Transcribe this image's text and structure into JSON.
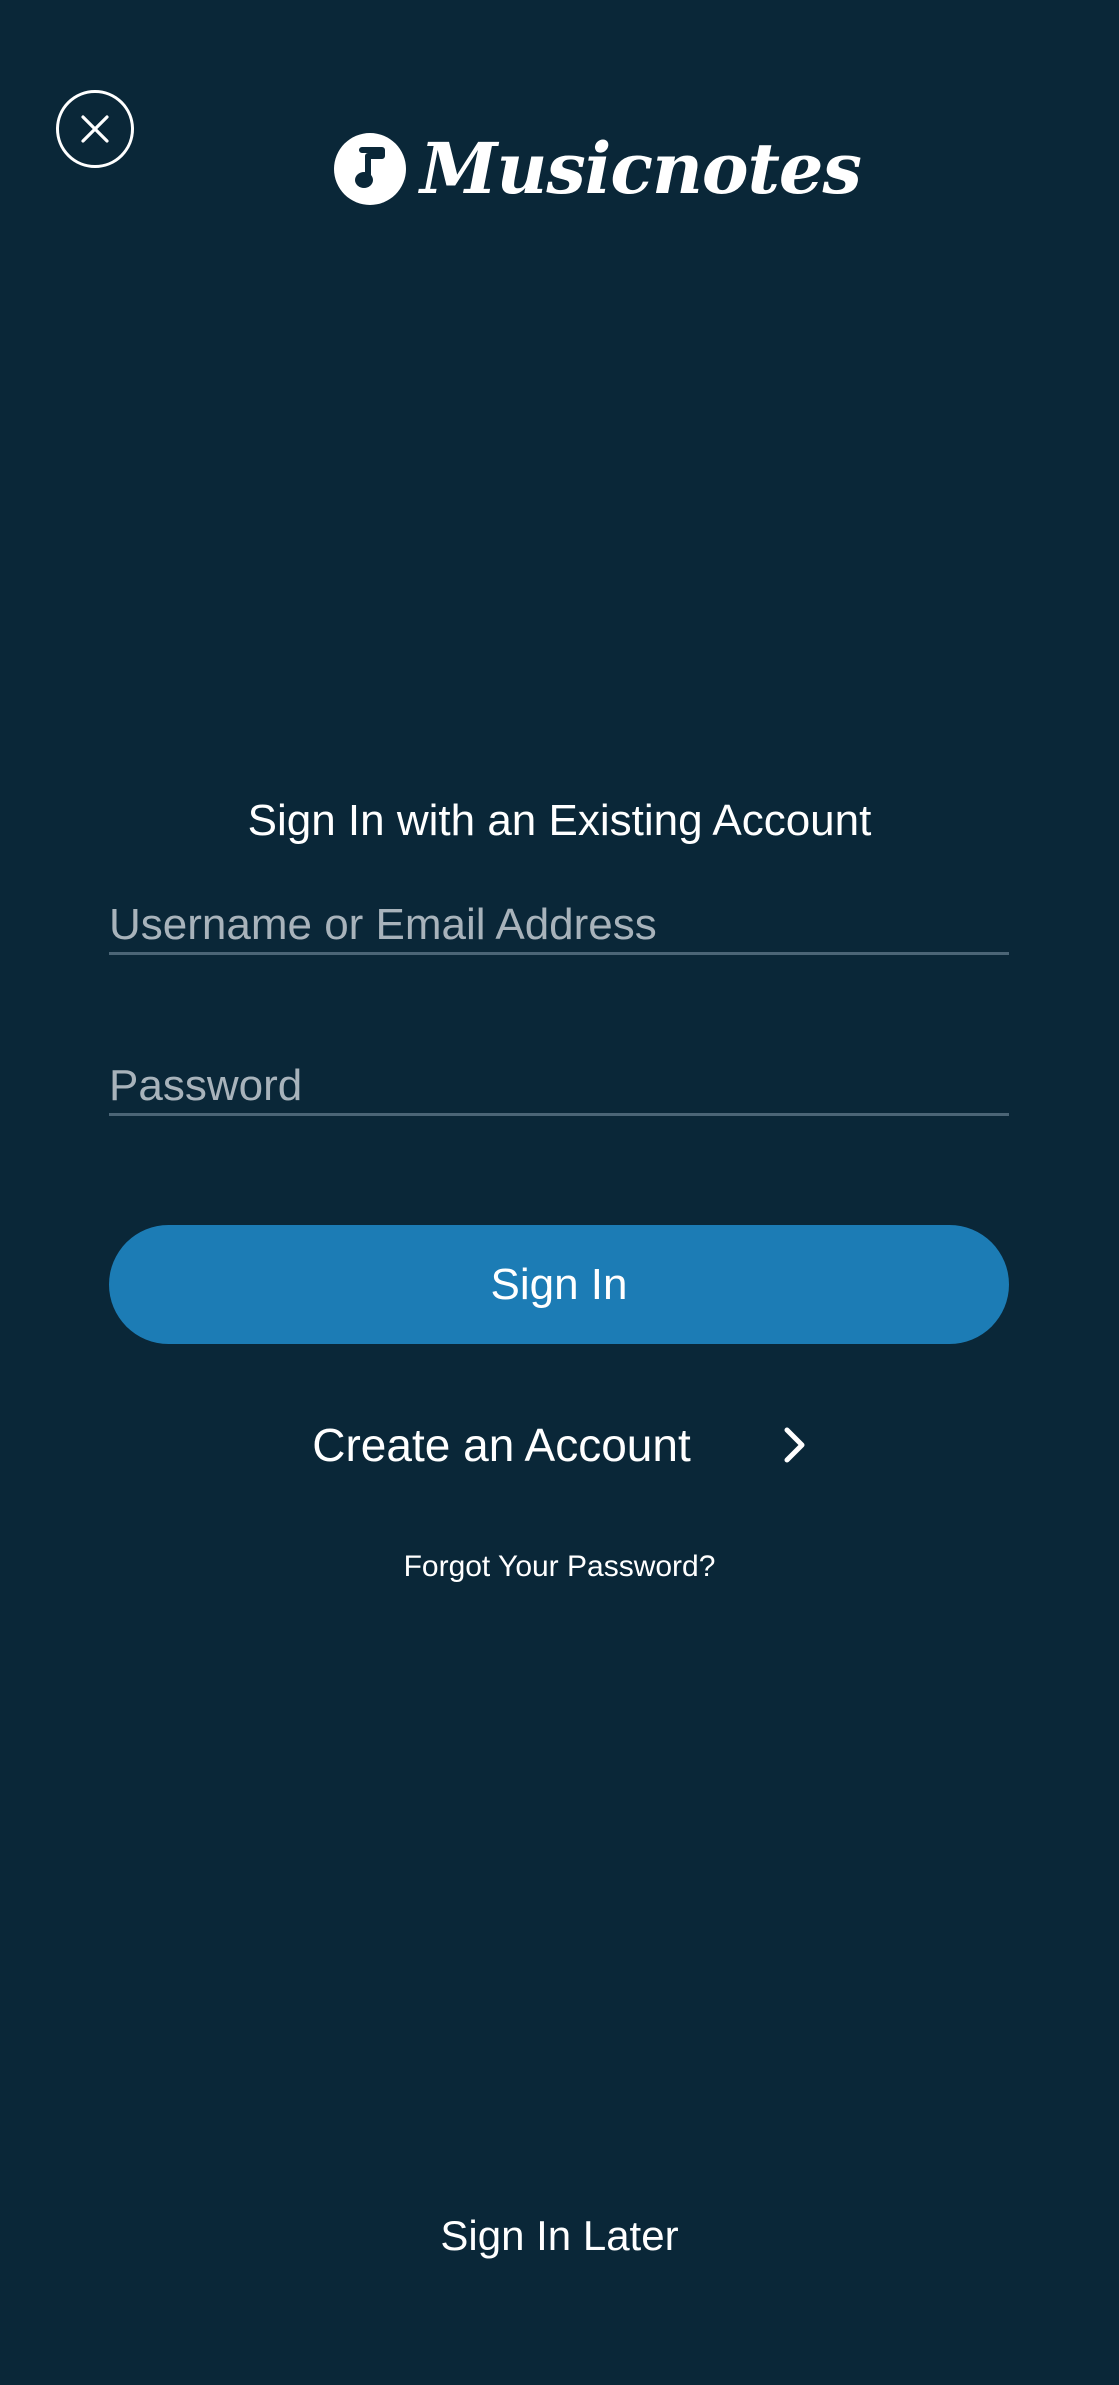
{
  "header": {
    "close_icon": "close-icon",
    "logo_text": "Musicnotes",
    "logo_icon": "music-note-icon"
  },
  "form": {
    "heading": "Sign In with an Existing Account",
    "username_placeholder": "Username or Email Address",
    "username_value": "",
    "password_placeholder": "Password",
    "password_value": "",
    "sign_in_label": "Sign In"
  },
  "links": {
    "create_account_label": "Create an Account",
    "create_account_icon": "chevron-right-icon",
    "forgot_password_label": "Forgot Your Password?",
    "sign_in_later_label": "Sign In Later"
  },
  "colors": {
    "background": "#0a2738",
    "primary_button": "#1c7cb5",
    "field_underline": "#4b6576",
    "placeholder": "#a8b3bb",
    "text": "#ffffff"
  }
}
